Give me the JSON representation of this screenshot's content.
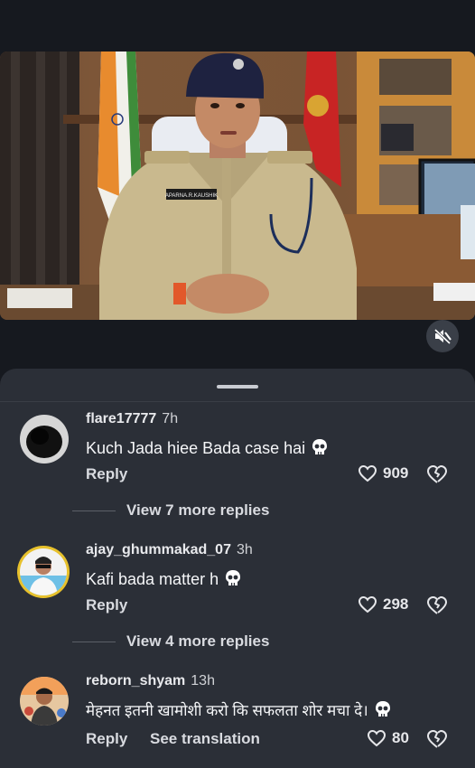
{
  "video": {
    "badge_text": "APARNA.R.KAUSHIK",
    "mute_icon": "speaker-muted-icon"
  },
  "comments": [
    {
      "username": "flare17777",
      "time": "7h",
      "text": "Kuch Jada hiee Bada case hai",
      "reply_label": "Reply",
      "likes": "909",
      "view_replies": "View 7 more replies"
    },
    {
      "username": "ajay_ghummakad_07",
      "time": "3h",
      "text": "Kafi bada matter h",
      "reply_label": "Reply",
      "likes": "298",
      "view_replies": "View 4 more replies"
    },
    {
      "username": "reborn_shyam",
      "time": "13h",
      "text": "मेहनत इतनी खामोशी करो कि सफलता शोर मचा दे।",
      "reply_label": "Reply",
      "translate_label": "See translation",
      "likes": "80"
    }
  ],
  "colors": {
    "background": "#16191f",
    "sheet": "#2b2f37",
    "story_ring": "#e7c12c"
  }
}
